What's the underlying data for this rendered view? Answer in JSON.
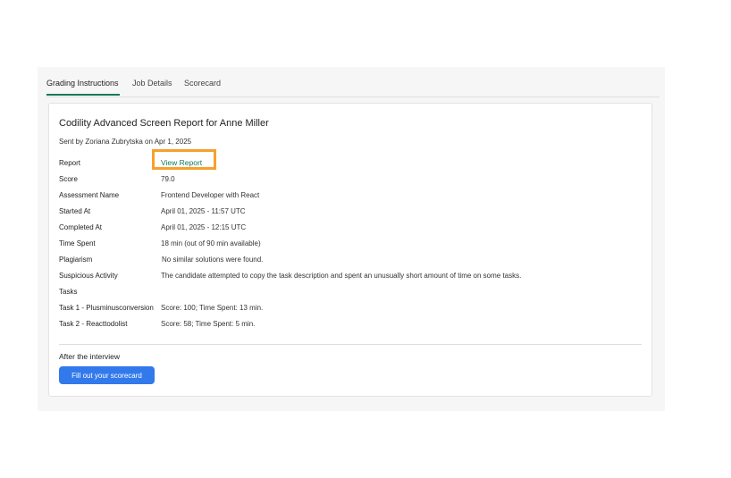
{
  "tabs": [
    {
      "label": "Grading Instructions",
      "active": true
    },
    {
      "label": "Job Details",
      "active": false
    },
    {
      "label": "Scorecard",
      "active": false
    }
  ],
  "report": {
    "title": "Codility Advanced Screen Report for Anne Miller",
    "sent_by": "Sent by Zoriana Zubrytska on Apr 1, 2025",
    "report_label": "Report",
    "view_report_link": "View Report",
    "rows": [
      {
        "label": "Score",
        "value": "79.0"
      },
      {
        "label": "Assessment Name",
        "value": "Frontend Developer with React"
      },
      {
        "label": "Started At",
        "value": "April 01, 2025 - 11:57 UTC"
      },
      {
        "label": "Completed At",
        "value": "April 01, 2025 - 12:15 UTC"
      },
      {
        "label": "Time Spent",
        "value": "18 min (out of 90 min available)"
      },
      {
        "label": "Plagiarism",
        "value": "No similar solutions were found."
      },
      {
        "label": "Suspicious Activity",
        "value": "The candidate attempted to copy the task description and spent an unusually short amount of time on some tasks."
      },
      {
        "label": "Tasks",
        "value": ""
      },
      {
        "label": "Task 1 - Plusminusconversion",
        "value": "Score: 100; Time Spent: 13 min."
      },
      {
        "label": "Task 2 - Reacttodolist",
        "value": "Score: 58; Time Spent: 5 min."
      }
    ]
  },
  "after_interview": {
    "label": "After the interview",
    "button_label": "Fill out your scorecard"
  },
  "colors": {
    "accent_green": "#127a5c",
    "highlight_orange": "#f7a02e",
    "button_blue": "#3279ec"
  }
}
